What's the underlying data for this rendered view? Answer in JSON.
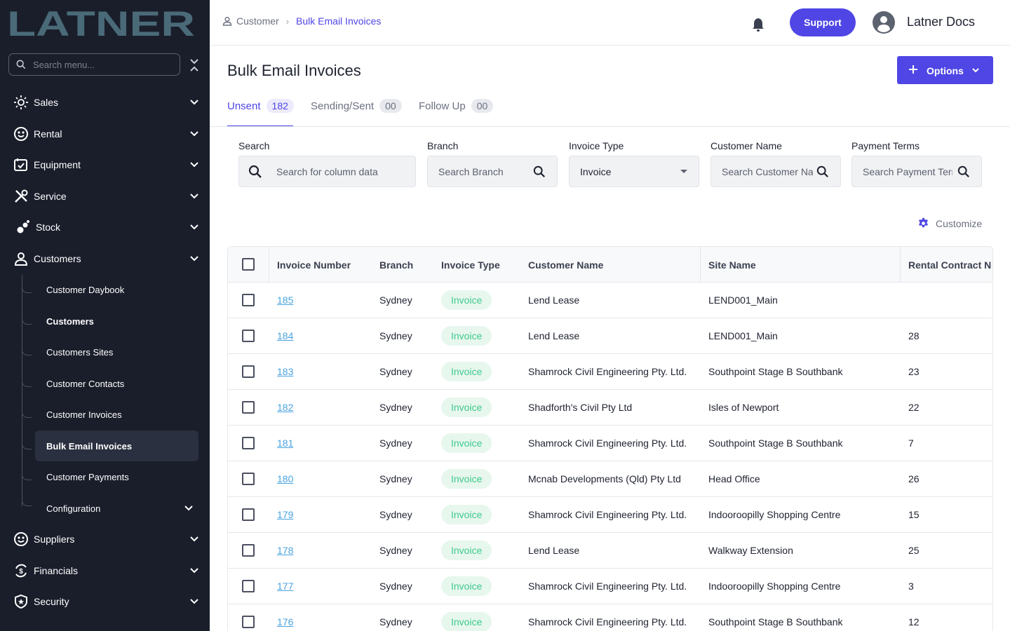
{
  "brand": {
    "logo_text": "LATNER",
    "accent": "#4f46e5",
    "sidebar_bg": "#1a1e2b"
  },
  "sidebar": {
    "search_placeholder": "Search menu...",
    "items": [
      {
        "label": "Sales",
        "icon": "sales-icon"
      },
      {
        "label": "Rental",
        "icon": "rental-icon"
      },
      {
        "label": "Equipment",
        "icon": "equipment-icon"
      },
      {
        "label": "Service",
        "icon": "service-icon"
      },
      {
        "label": "Stock",
        "icon": "stock-icon"
      },
      {
        "label": "Customers",
        "icon": "user-icon"
      },
      {
        "label": "Suppliers",
        "icon": "suppliers-icon"
      },
      {
        "label": "Financials",
        "icon": "financials-icon"
      },
      {
        "label": "Security",
        "icon": "shield-icon"
      }
    ],
    "customers_sub": [
      {
        "label": "Customer Daybook"
      },
      {
        "label": "Customers"
      },
      {
        "label": "Customers Sites"
      },
      {
        "label": "Customer Contacts"
      },
      {
        "label": "Customer Invoices"
      },
      {
        "label": "Bulk Email Invoices"
      },
      {
        "label": "Customer Payments"
      },
      {
        "label": "Configuration"
      }
    ]
  },
  "header": {
    "breadcrumb_parent": "Customer",
    "breadcrumb_current": "Bulk Email Invoices",
    "support_label": "Support",
    "user_name": "Latner Docs"
  },
  "page": {
    "title": "Bulk Email Invoices",
    "options_label": "Options",
    "tabs": [
      {
        "label": "Unsent",
        "count": "182"
      },
      {
        "label": "Sending/Sent",
        "count": "00"
      },
      {
        "label": "Follow Up",
        "count": "00"
      }
    ]
  },
  "filters": {
    "search_label": "Search",
    "search_placeholder": "Search for column data",
    "branch_label": "Branch",
    "branch_placeholder": "Search Branch",
    "invoice_type_label": "Invoice Type",
    "invoice_type_value": "Invoice",
    "customer_name_label": "Customer Name",
    "customer_name_placeholder": "Search Customer Name",
    "payment_terms_label": "Payment Terms",
    "payment_terms_placeholder": "Search Payment Terms",
    "customize_label": "Customize"
  },
  "table": {
    "columns": [
      "Invoice Number",
      "Branch",
      "Invoice Type",
      "Customer Name",
      "Site Name",
      "Rental Contract N"
    ],
    "rows": [
      {
        "invoice": "185",
        "branch": "Sydney",
        "type": "Invoice",
        "customer": "Lend Lease",
        "site": "LEND001_Main",
        "contract": ""
      },
      {
        "invoice": "184",
        "branch": "Sydney",
        "type": "Invoice",
        "customer": "Lend Lease",
        "site": "LEND001_Main",
        "contract": "28"
      },
      {
        "invoice": "183",
        "branch": "Sydney",
        "type": "Invoice",
        "customer": "Shamrock Civil Engineering Pty. Ltd.",
        "site": "Southpoint Stage B Southbank",
        "contract": "23"
      },
      {
        "invoice": "182",
        "branch": "Sydney",
        "type": "Invoice",
        "customer": "Shadforth's Civil Pty Ltd",
        "site": "Isles of Newport",
        "contract": "22"
      },
      {
        "invoice": "181",
        "branch": "Sydney",
        "type": "Invoice",
        "customer": "Shamrock Civil Engineering Pty. Ltd.",
        "site": "Southpoint Stage B Southbank",
        "contract": "7"
      },
      {
        "invoice": "180",
        "branch": "Sydney",
        "type": "Invoice",
        "customer": "Mcnab Developments (Qld) Pty Ltd",
        "site": "Head Office",
        "contract": "26"
      },
      {
        "invoice": "179",
        "branch": "Sydney",
        "type": "Invoice",
        "customer": "Shamrock Civil Engineering Pty. Ltd.",
        "site": "Indooroopilly Shopping Centre",
        "contract": "15"
      },
      {
        "invoice": "178",
        "branch": "Sydney",
        "type": "Invoice",
        "customer": "Lend Lease",
        "site": "Walkway Extension",
        "contract": "25"
      },
      {
        "invoice": "177",
        "branch": "Sydney",
        "type": "Invoice",
        "customer": "Shamrock Civil Engineering Pty. Ltd.",
        "site": "Indooroopilly Shopping Centre",
        "contract": "3"
      },
      {
        "invoice": "176",
        "branch": "Sydney",
        "type": "Invoice",
        "customer": "Shamrock Civil Engineering Pty. Ltd.",
        "site": "Southpoint Stage B Southbank",
        "contract": "12"
      }
    ]
  }
}
